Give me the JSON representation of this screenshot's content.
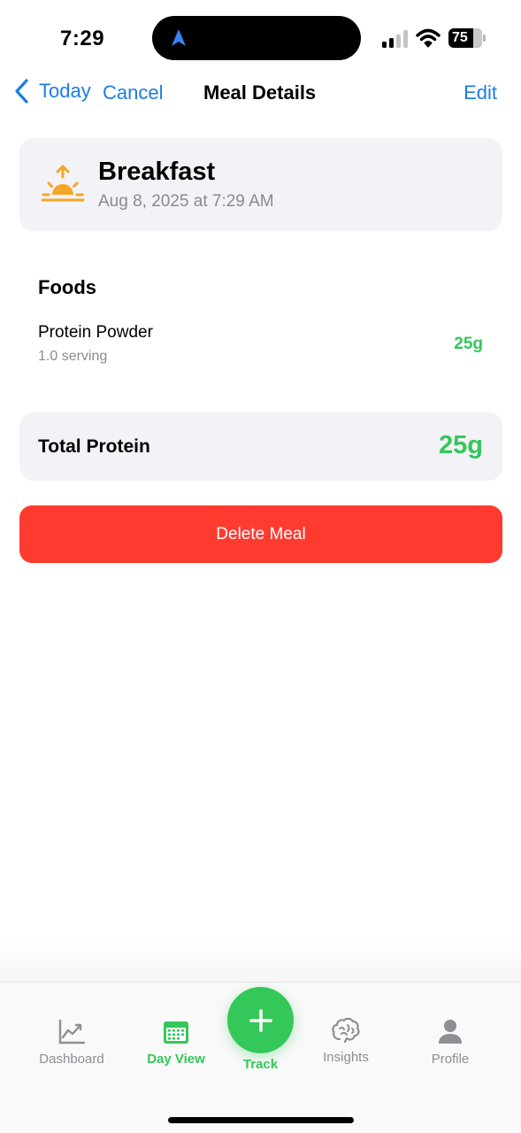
{
  "status_bar": {
    "time": "7:29",
    "battery": "75",
    "icons": [
      "location-arrow-icon",
      "signal-icon",
      "wifi-icon",
      "battery-icon"
    ]
  },
  "nav": {
    "back_label": "Today",
    "cancel_label": "Cancel",
    "title": "Meal Details",
    "edit_label": "Edit"
  },
  "meal": {
    "icon": "sunrise-icon",
    "name": "Breakfast",
    "datetime": "Aug 8, 2025 at 7:29 AM"
  },
  "foods": {
    "heading": "Foods",
    "items": [
      {
        "name": "Protein Powder",
        "serving": "1.0 serving",
        "protein": "25g"
      }
    ]
  },
  "total": {
    "label": "Total Protein",
    "value": "25g"
  },
  "actions": {
    "delete_label": "Delete Meal"
  },
  "tab_bar": {
    "tabs": [
      {
        "label": "Dashboard",
        "icon": "chart-line-icon",
        "active": false
      },
      {
        "label": "Day View",
        "icon": "calendar-icon",
        "active": true
      },
      {
        "label": "Track",
        "icon": "plus-icon",
        "active": false
      },
      {
        "label": "Insights",
        "icon": "brain-icon",
        "active": false
      },
      {
        "label": "Profile",
        "icon": "person-icon",
        "active": false
      }
    ]
  },
  "colors": {
    "accent_blue": "#1b7ce4",
    "accent_green": "#34c759",
    "destructive_red": "#ff3b30",
    "card_background": "#f2f2f7",
    "secondary_text": "#8a8a8e",
    "sun_orange": "#f5a623"
  }
}
